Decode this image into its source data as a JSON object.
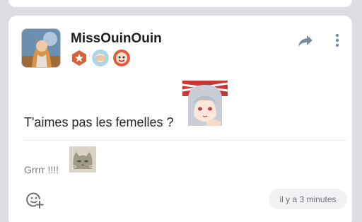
{
  "post": {
    "username": "MissOuinOuin",
    "text": "T'aimes pas les femelles ?",
    "comment": "Grrrr !!!!",
    "timestamp": "il y a 3 minutes"
  },
  "icons": {
    "share": "share-arrow-icon",
    "more": "vertical-dots-icon",
    "react": "add-emoji-icon"
  },
  "badges": [
    {
      "name": "star-badge",
      "color": "#d9623a"
    },
    {
      "name": "old-man-badge",
      "color": "#a8d8ea"
    },
    {
      "name": "character-badge",
      "color": "#e45a3a"
    }
  ]
}
